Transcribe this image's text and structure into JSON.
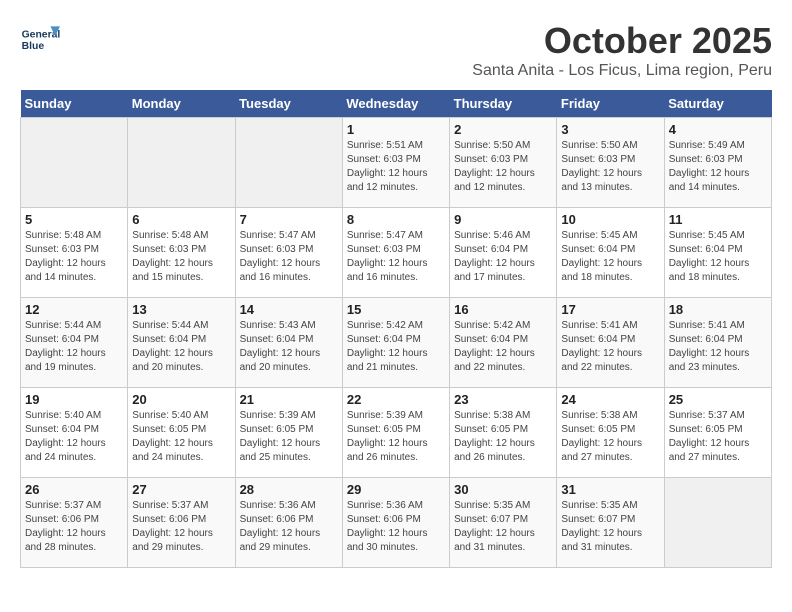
{
  "header": {
    "logo_line1": "General",
    "logo_line2": "Blue",
    "month": "October 2025",
    "location": "Santa Anita - Los Ficus, Lima region, Peru"
  },
  "weekdays": [
    "Sunday",
    "Monday",
    "Tuesday",
    "Wednesday",
    "Thursday",
    "Friday",
    "Saturday"
  ],
  "weeks": [
    [
      {
        "day": "",
        "info": ""
      },
      {
        "day": "",
        "info": ""
      },
      {
        "day": "",
        "info": ""
      },
      {
        "day": "1",
        "info": "Sunrise: 5:51 AM\nSunset: 6:03 PM\nDaylight: 12 hours and 12 minutes."
      },
      {
        "day": "2",
        "info": "Sunrise: 5:50 AM\nSunset: 6:03 PM\nDaylight: 12 hours and 12 minutes."
      },
      {
        "day": "3",
        "info": "Sunrise: 5:50 AM\nSunset: 6:03 PM\nDaylight: 12 hours and 13 minutes."
      },
      {
        "day": "4",
        "info": "Sunrise: 5:49 AM\nSunset: 6:03 PM\nDaylight: 12 hours and 14 minutes."
      }
    ],
    [
      {
        "day": "5",
        "info": "Sunrise: 5:48 AM\nSunset: 6:03 PM\nDaylight: 12 hours and 14 minutes."
      },
      {
        "day": "6",
        "info": "Sunrise: 5:48 AM\nSunset: 6:03 PM\nDaylight: 12 hours and 15 minutes."
      },
      {
        "day": "7",
        "info": "Sunrise: 5:47 AM\nSunset: 6:03 PM\nDaylight: 12 hours and 16 minutes."
      },
      {
        "day": "8",
        "info": "Sunrise: 5:47 AM\nSunset: 6:03 PM\nDaylight: 12 hours and 16 minutes."
      },
      {
        "day": "9",
        "info": "Sunrise: 5:46 AM\nSunset: 6:04 PM\nDaylight: 12 hours and 17 minutes."
      },
      {
        "day": "10",
        "info": "Sunrise: 5:45 AM\nSunset: 6:04 PM\nDaylight: 12 hours and 18 minutes."
      },
      {
        "day": "11",
        "info": "Sunrise: 5:45 AM\nSunset: 6:04 PM\nDaylight: 12 hours and 18 minutes."
      }
    ],
    [
      {
        "day": "12",
        "info": "Sunrise: 5:44 AM\nSunset: 6:04 PM\nDaylight: 12 hours and 19 minutes."
      },
      {
        "day": "13",
        "info": "Sunrise: 5:44 AM\nSunset: 6:04 PM\nDaylight: 12 hours and 20 minutes."
      },
      {
        "day": "14",
        "info": "Sunrise: 5:43 AM\nSunset: 6:04 PM\nDaylight: 12 hours and 20 minutes."
      },
      {
        "day": "15",
        "info": "Sunrise: 5:42 AM\nSunset: 6:04 PM\nDaylight: 12 hours and 21 minutes."
      },
      {
        "day": "16",
        "info": "Sunrise: 5:42 AM\nSunset: 6:04 PM\nDaylight: 12 hours and 22 minutes."
      },
      {
        "day": "17",
        "info": "Sunrise: 5:41 AM\nSunset: 6:04 PM\nDaylight: 12 hours and 22 minutes."
      },
      {
        "day": "18",
        "info": "Sunrise: 5:41 AM\nSunset: 6:04 PM\nDaylight: 12 hours and 23 minutes."
      }
    ],
    [
      {
        "day": "19",
        "info": "Sunrise: 5:40 AM\nSunset: 6:04 PM\nDaylight: 12 hours and 24 minutes."
      },
      {
        "day": "20",
        "info": "Sunrise: 5:40 AM\nSunset: 6:05 PM\nDaylight: 12 hours and 24 minutes."
      },
      {
        "day": "21",
        "info": "Sunrise: 5:39 AM\nSunset: 6:05 PM\nDaylight: 12 hours and 25 minutes."
      },
      {
        "day": "22",
        "info": "Sunrise: 5:39 AM\nSunset: 6:05 PM\nDaylight: 12 hours and 26 minutes."
      },
      {
        "day": "23",
        "info": "Sunrise: 5:38 AM\nSunset: 6:05 PM\nDaylight: 12 hours and 26 minutes."
      },
      {
        "day": "24",
        "info": "Sunrise: 5:38 AM\nSunset: 6:05 PM\nDaylight: 12 hours and 27 minutes."
      },
      {
        "day": "25",
        "info": "Sunrise: 5:37 AM\nSunset: 6:05 PM\nDaylight: 12 hours and 27 minutes."
      }
    ],
    [
      {
        "day": "26",
        "info": "Sunrise: 5:37 AM\nSunset: 6:06 PM\nDaylight: 12 hours and 28 minutes."
      },
      {
        "day": "27",
        "info": "Sunrise: 5:37 AM\nSunset: 6:06 PM\nDaylight: 12 hours and 29 minutes."
      },
      {
        "day": "28",
        "info": "Sunrise: 5:36 AM\nSunset: 6:06 PM\nDaylight: 12 hours and 29 minutes."
      },
      {
        "day": "29",
        "info": "Sunrise: 5:36 AM\nSunset: 6:06 PM\nDaylight: 12 hours and 30 minutes."
      },
      {
        "day": "30",
        "info": "Sunrise: 5:35 AM\nSunset: 6:07 PM\nDaylight: 12 hours and 31 minutes."
      },
      {
        "day": "31",
        "info": "Sunrise: 5:35 AM\nSunset: 6:07 PM\nDaylight: 12 hours and 31 minutes."
      },
      {
        "day": "",
        "info": ""
      }
    ]
  ]
}
